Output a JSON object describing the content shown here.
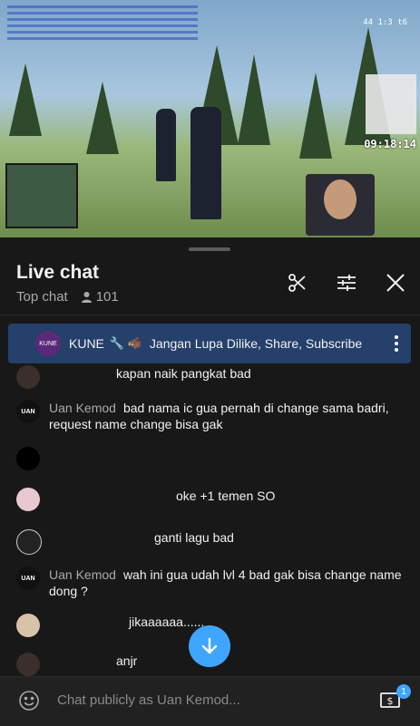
{
  "video": {
    "clock": "09:18:14",
    "corner_text": "44 1:3 t6"
  },
  "chat": {
    "title": "Live chat",
    "mode": "Top chat",
    "viewer_count": "101",
    "pinned": {
      "author": "KUNE",
      "emojis": "🔧 🐗",
      "message": "Jangan Lupa Dilike, Share, Subscribe J",
      "avatar_text": "KUNE"
    },
    "messages": [
      {
        "name": "",
        "text": "kapan naik pangkat bad",
        "avatar_color": "#3a2f2a",
        "avatar_text": ""
      },
      {
        "name": "Uan Kemod",
        "text": "bad nama ic gua pernah di change sama badri, request name change bisa gak",
        "avatar_color": "#111111",
        "avatar_text": "UAN"
      },
      {
        "name": "",
        "text": "",
        "avatar_color": "#000000",
        "avatar_text": ""
      },
      {
        "name": "",
        "text": "oke +1 temen SO",
        "avatar_color": "#e8c9cf",
        "avatar_text": ""
      },
      {
        "name": "",
        "text": "ganti lagu bad",
        "avatar_color": "#222222",
        "avatar_text": ""
      },
      {
        "name": "Uan Kemod",
        "text": "wah ini gua udah lvl 4 bad gak bisa change name dong ?",
        "avatar_color": "#111111",
        "avatar_text": "UAN"
      },
      {
        "name": "",
        "text": "jikaaaaaa......",
        "avatar_color": "#d8c2a8",
        "avatar_text": ""
      },
      {
        "name": "",
        "text": "anjr",
        "avatar_color": "#3a2f2a",
        "avatar_text": ""
      }
    ],
    "input_placeholder": "Chat publicly as Uan Kemod...",
    "super_chat_badge": "1"
  },
  "colors": {
    "accent": "#3ea6ff",
    "pinned_bg": "#25406a",
    "panel_bg": "#181818"
  }
}
